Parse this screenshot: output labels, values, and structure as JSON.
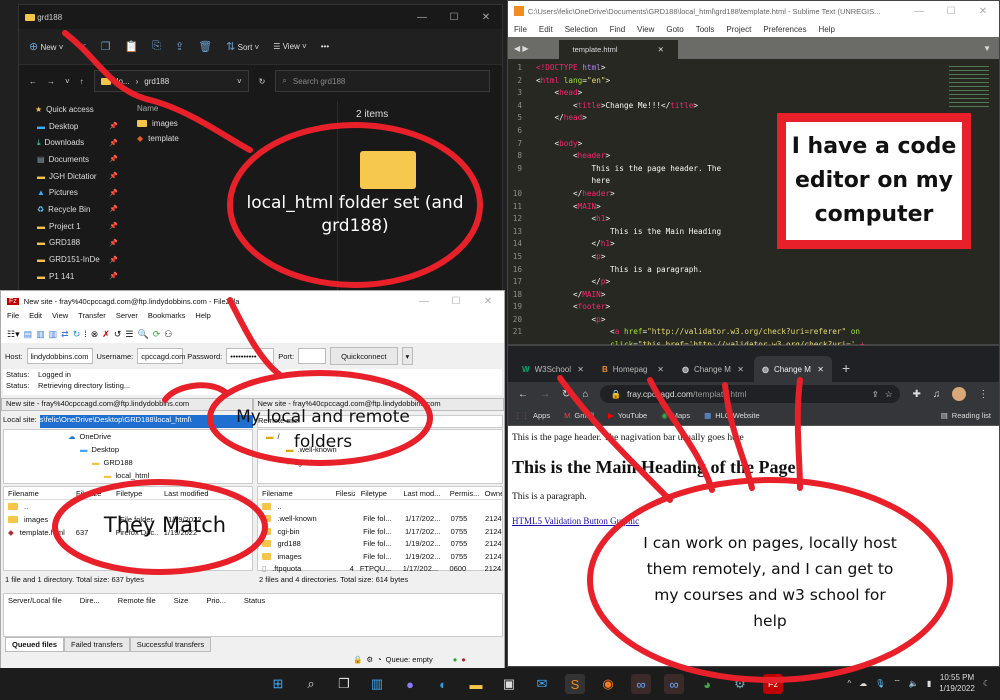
{
  "explorer": {
    "title": "grd188",
    "toolbar": {
      "new": "New",
      "sort": "Sort",
      "view": "View",
      "more": "•••"
    },
    "path": {
      "prefix": "lo...",
      "sep": "›",
      "current": "grd188"
    },
    "search_placeholder": "Search grd188",
    "sidebar": [
      {
        "label": "Quick access",
        "icon": "star-icon"
      },
      {
        "label": "Desktop",
        "icon": "desktop-icon"
      },
      {
        "label": "Downloads",
        "icon": "download-icon"
      },
      {
        "label": "Documents",
        "icon": "document-icon"
      },
      {
        "label": "JGH Dictatior",
        "icon": "folder-icon"
      },
      {
        "label": "Pictures",
        "icon": "pictures-icon"
      },
      {
        "label": "Recycle Bin",
        "icon": "recycle-bin-icon"
      },
      {
        "label": "Project 1",
        "icon": "folder-icon"
      },
      {
        "label": "GRD188",
        "icon": "folder-icon"
      },
      {
        "label": "GRD151-InDe",
        "icon": "folder-icon"
      },
      {
        "label": "P1 141",
        "icon": "folder-icon"
      }
    ],
    "column_name": "Name",
    "files": [
      {
        "name": "images",
        "icon": "folder-icon"
      },
      {
        "name": "template",
        "icon": "html-file-icon"
      }
    ],
    "item_count": "2 items"
  },
  "sublime": {
    "title": "C:\\Users\\felic\\OneDrive\\Documents\\GRD188\\local_html\\grd188\\template.html - Sublime Text (UNREGIS...",
    "menu": [
      "File",
      "Edit",
      "Selection",
      "Find",
      "View",
      "Goto",
      "Tools",
      "Project",
      "Preferences",
      "Help"
    ],
    "tab": "template.html",
    "lines": [
      {
        "n": "1",
        "html": "<span class='t'>&lt;!DOCTYPE</span> <span class='k'>html</span>&gt;"
      },
      {
        "n": "2",
        "html": "&lt;<span class='t'>html</span> <span class='a'>lang</span>=<span class='s'>\"en\"</span>&gt;"
      },
      {
        "n": "3",
        "html": "    &lt;<span class='t'>head</span>&gt;"
      },
      {
        "n": "4",
        "html": "        &lt;<span class='t'>title</span>&gt;Change Me!!!&lt;/<span class='t'>title</span>&gt;"
      },
      {
        "n": "5",
        "html": "    &lt;/<span class='t'>head</span>&gt;"
      },
      {
        "n": "6",
        "html": ""
      },
      {
        "n": "7",
        "html": "    &lt;<span class='t'>body</span>&gt;"
      },
      {
        "n": "8",
        "html": "        &lt;<span class='t'>header</span>&gt;"
      },
      {
        "n": "9",
        "html": "            This is the page header. The"
      },
      {
        "n": "",
        "html": "            here"
      },
      {
        "n": "10",
        "html": "        &lt;/<span class='t'>header</span>&gt;"
      },
      {
        "n": "11",
        "html": "        &lt;<span class='t'>MAIN</span>&gt;"
      },
      {
        "n": "12",
        "html": "            &lt;<span class='t'>h1</span>&gt;"
      },
      {
        "n": "13",
        "html": "                This is the Main Heading"
      },
      {
        "n": "14",
        "html": "            &lt;/<span class='t'>h1</span>&gt;"
      },
      {
        "n": "15",
        "html": "            &lt;<span class='t'>p</span>&gt;"
      },
      {
        "n": "16",
        "html": "                This is a paragraph."
      },
      {
        "n": "17",
        "html": "            &lt;/<span class='t'>p</span>&gt;"
      },
      {
        "n": "18",
        "html": "        &lt;/<span class='t'>MAIN</span>&gt;"
      },
      {
        "n": "19",
        "html": "        &lt;<span class='t'>footer</span>&gt;"
      },
      {
        "n": "20",
        "html": "            &lt;<span class='t'>p</span>&gt;"
      },
      {
        "n": "21",
        "html": "                &lt;<span class='t'>a</span> <span class='a'>href</span>=<span class='s'>\"http://validator.w3.org/check?uri=referer\"</span> <span class='a'>on</span>"
      },
      {
        "n": "",
        "html": "                <span class='a'>click</span>=<span class='s'>\"this.href='http://validator.w3.org/check?uri='</span> <span class='t'>+</span>"
      }
    ]
  },
  "filezilla": {
    "title": "New site - fray%40cpccagd.com@ftp.lindydobbins.com - FileZilla",
    "menu": [
      "File",
      "Edit",
      "View",
      "Transfer",
      "Server",
      "Bookmarks",
      "Help"
    ],
    "host_label": "Host:",
    "host": "lindydobbins.com",
    "user_label": "Username:",
    "user": "cpccagd.com",
    "pass_label": "Password:",
    "pass": "••••••••••",
    "port_label": "Port:",
    "port": "",
    "quickconnect": "Quickconnect",
    "log": [
      {
        "k": "Status:",
        "v": "Logged in"
      },
      {
        "k": "Status:",
        "v": "Retrieving directory listing..."
      }
    ],
    "site_tabs": [
      "New site - fray%40cpccagd.com@ftp.lindydobbins.com",
      "New site - fray%40cpccagd.com@ftp.lindydobbins.com"
    ],
    "local_site_label": "Local site:",
    "local_site_path": "s\\felic\\OneDrive\\Desktop\\GRD188\\local_html\\",
    "remote_site_label": "Remote site:",
    "local_tree": [
      "OneDrive",
      "Desktop",
      "GRD188",
      "local_html"
    ],
    "remote_tree": [
      "/",
      ".well-known",
      "cgi-bin"
    ],
    "local_columns": [
      "Filename",
      "Filesize",
      "Filetype",
      "Last modified"
    ],
    "local_files": [
      {
        "name": "..",
        "size": "",
        "type": "",
        "date": ""
      },
      {
        "name": "images",
        "size": "",
        "type": "File folder",
        "date": "1/19/2022"
      },
      {
        "name": "template.html",
        "size": "637",
        "type": "Firefox Doc...",
        "date": "1/19/2022"
      }
    ],
    "remote_columns": [
      "Filename",
      "Filesize",
      "Filetype",
      "Last mod...",
      "Permis...",
      "Owne"
    ],
    "remote_files": [
      {
        "name": "..",
        "size": "",
        "type": "",
        "date": "",
        "perm": "",
        "owner": ""
      },
      {
        "name": ".well-known",
        "size": "",
        "type": "File fol...",
        "date": "1/17/202...",
        "perm": "0755",
        "owner": "2124"
      },
      {
        "name": "cgi-bin",
        "size": "",
        "type": "File fol...",
        "date": "1/17/202...",
        "perm": "0755",
        "owner": "2124"
      },
      {
        "name": "grd188",
        "size": "",
        "type": "File fol...",
        "date": "1/19/202...",
        "perm": "0755",
        "owner": "2124"
      },
      {
        "name": "images",
        "size": "",
        "type": "File fol...",
        "date": "1/19/202...",
        "perm": "0755",
        "owner": "2124"
      },
      {
        "name": ".ftpquota",
        "size": "4",
        "type": "FTPQU...",
        "date": "1/17/202...",
        "perm": "0600",
        "owner": "2124"
      }
    ],
    "local_status": "1 file and 1 directory. Total size: 637 bytes",
    "remote_status": "2 files and 4 directories. Total size: 614 bytes",
    "queue_columns": [
      "Server/Local file",
      "Dire...",
      "Remote file",
      "Size",
      "Prio...",
      "Status"
    ],
    "queue_tabs": [
      "Queued files",
      "Failed transfers",
      "Successful transfers"
    ],
    "queue_status": "Queue: empty"
  },
  "chrome": {
    "tabs": [
      {
        "label": "W3School",
        "icon": "w3schools-icon"
      },
      {
        "label": "Homepag",
        "icon": "blackboard-icon"
      },
      {
        "label": "Change M",
        "icon": "globe-icon"
      },
      {
        "label": "Change M",
        "icon": "globe-icon"
      }
    ],
    "url_host": "fray.cpccagd.com",
    "url_path": "/template.html",
    "bookmarks": [
      "Apps",
      "Gmail",
      "YouTube",
      "Maps",
      "HLG Website"
    ],
    "reading_list": "Reading list",
    "page": {
      "header": "This is the page header. The nagivation bar usually goes here",
      "h1": "This is the Main Heading of the Page",
      "p": "This is a paragraph.",
      "link": "HTML5 Validation Button Graphic"
    }
  },
  "taskbar": {
    "time": "10:55 PM",
    "date": "1/19/2022"
  },
  "annotations": {
    "explorer_note": "local_html folder set (and grd188)",
    "editor_note": "I have a code editor on my computer",
    "folders_note": "My local and remote folders",
    "match_note": "They Match",
    "browser_note": "I can work on pages, locally host them remotely, and I can get to my courses and w3 school for help"
  },
  "colors": {
    "annotation_red": "#e8202a",
    "folder_yellow": "#f4c54a",
    "sublime_bg": "#272822"
  }
}
